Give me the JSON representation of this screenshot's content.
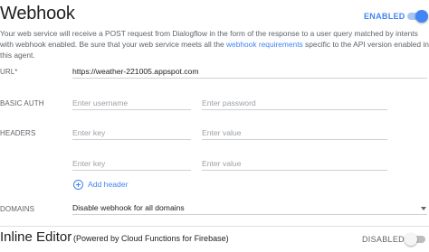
{
  "webhook": {
    "title": "Webhook",
    "toggle_state_label": "ENABLED",
    "toggle_on": true,
    "description_part1": "Your web service will receive a POST request from Dialogflow in the form of the response to a user query matched by intents with webhook enabled. Be sure that your web service meets all the ",
    "description_link": "webhook requirements",
    "description_part2": " specific to the API version enabled in this agent.",
    "url": {
      "label": "URL*",
      "value": "https://weather-221005.appspot.com"
    },
    "basic_auth": {
      "label": "BASIC AUTH",
      "username_placeholder": "Enter username",
      "password_placeholder": "Enter password"
    },
    "headers": {
      "label": "HEADERS",
      "rows": [
        {
          "key_placeholder": "Enter key",
          "value_placeholder": "Enter value"
        },
        {
          "key_placeholder": "Enter key",
          "value_placeholder": "Enter value"
        }
      ],
      "add_label": "Add header"
    },
    "domains": {
      "label": "DOMAINS",
      "selected": "Disable webhook for all domains"
    }
  },
  "inline_editor": {
    "title": "Inline Editor",
    "subtitle": "(Powered by Cloud Functions for Firebase)",
    "toggle_state_label": "DISABLED",
    "toggle_on": false
  },
  "colors": {
    "accent": "#4285f4",
    "text": "#202124",
    "muted": "#5f6368",
    "placeholder": "#9aa0a6"
  }
}
